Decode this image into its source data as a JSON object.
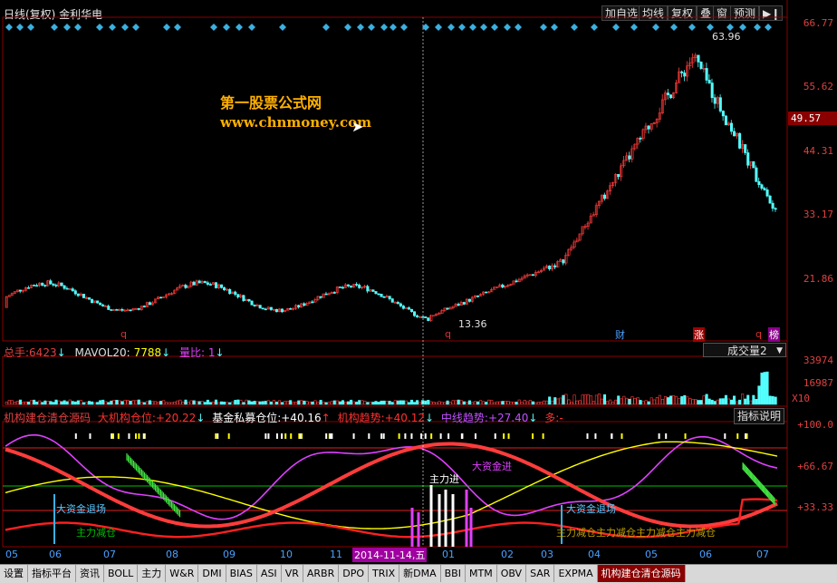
{
  "header": {
    "title": "日线(复权) 金利华电",
    "buttons": [
      "加自选",
      "均线",
      "复权",
      "叠",
      "窗",
      "预测"
    ],
    "nav_arrows": "▶❙"
  },
  "watermark": {
    "line1": "第一股票公式网",
    "line2": "www.chnmoney.com"
  },
  "price_panel": {
    "y_ticks": [
      "66.77",
      "55.62",
      "44.31",
      "33.17",
      "21.86"
    ],
    "current_price": "49.57",
    "high_label": "63.96",
    "low_label": "13.36",
    "markers": [
      {
        "text": "q",
        "color": "#e03030"
      },
      {
        "text": "q",
        "color": "#e03030"
      },
      {
        "text": "财",
        "color": "#4aa0ff"
      },
      {
        "text": "涨",
        "color": "#ffffff"
      },
      {
        "text": "q",
        "color": "#e03030"
      },
      {
        "text": "榜",
        "color": "#ffffff"
      }
    ]
  },
  "volume_panel": {
    "total_label": "总手:",
    "total_value": "6423",
    "mavol_label": "MAVOL20:",
    "mavol_value": "7788",
    "ratio_label": "量比:",
    "ratio_value": "1",
    "dropdown": "成交量2",
    "y_ticks": [
      "33974",
      "16987"
    ],
    "unit": "X10"
  },
  "indicator_panel": {
    "name": "机构建仓清仓源码",
    "items": [
      {
        "label": "大机构仓位:",
        "value": "+20.22",
        "arrow": "↓",
        "color": "#ff3030"
      },
      {
        "label": "基金私募仓位:",
        "value": "+40.16",
        "arrow": "↑",
        "color": "#ffffff"
      },
      {
        "label": "机构趋势:",
        "value": "+40.12",
        "arrow": "↓",
        "color": "#ff3030"
      },
      {
        "label": "中线趋势:",
        "value": "+27.40",
        "arrow": "↓",
        "color": "#c050ff"
      },
      {
        "label": "多:",
        "value": "-",
        "arrow": "",
        "color": "#ff3030"
      }
    ],
    "help_button": "指标说明",
    "y_ticks": [
      "+100.0",
      "+66.67",
      "+33.33"
    ],
    "annotations": [
      "主力进",
      "大资金进",
      "大资金退场",
      "大资金退场",
      "主力减仓",
      "主力减仓主力减仓主力减仓主力减仓"
    ]
  },
  "x_axis": {
    "labels": [
      "05",
      "06",
      "07",
      "08",
      "09",
      "10",
      "11",
      "01",
      "02",
      "03",
      "04",
      "05",
      "06",
      "07"
    ],
    "cursor_date": "2014-11-14,五"
  },
  "tabs": [
    "设置",
    "指标平台",
    "资讯",
    "BOLL",
    "主力",
    "W&R",
    "DMI",
    "BIAS",
    "ASI",
    "VR",
    "ARBR",
    "DPO",
    "TRIX",
    "新DMA",
    "BBI",
    "MTM",
    "OBV",
    "SAR",
    "EXPMA",
    "机构建仓清仓源码"
  ],
  "colors": {
    "up": "#ff3c3c",
    "down": "#54ffff",
    "grid": "#7a0000",
    "accent": "#e02020",
    "yellow": "#ffff00",
    "magenta": "#e040ff",
    "green": "#00c000"
  },
  "chart_data": {
    "type": "candlestick",
    "title": "日线(复权) 金利华电",
    "ylim": [
      10,
      68
    ],
    "y_ticks": [
      66.77,
      55.62,
      44.31,
      33.17,
      21.86
    ],
    "high": 63.96,
    "low": 13.36,
    "last": 49.57,
    "x_period_labels": [
      "05",
      "06",
      "07",
      "08",
      "09",
      "10",
      "11",
      "01",
      "02",
      "03",
      "04",
      "05",
      "06",
      "07"
    ]
  }
}
